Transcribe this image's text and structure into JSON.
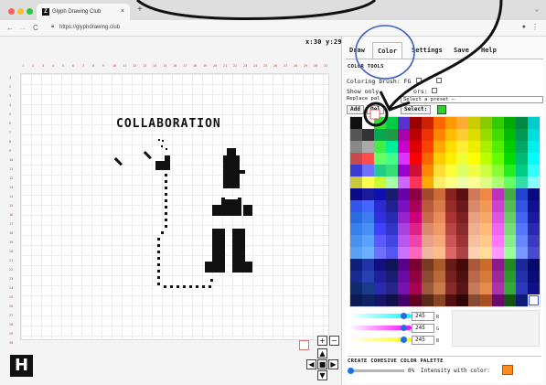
{
  "browser": {
    "tab_title": "Glyph Drawing Club",
    "tab_favicon": "Z",
    "new_tab": "+",
    "tab_menu": "⌄",
    "url": "https://glyphdrawing.club",
    "traffic_colors": {
      "close": "#ff5f57",
      "min": "#febc2e",
      "max": "#28c840"
    }
  },
  "workspace": {
    "coords": "x:30 y:29",
    "canvas_text": "COLLABORATION",
    "ruler_x": [
      "1",
      "2",
      "3",
      "4",
      "5",
      "6",
      "7",
      "8",
      "9",
      "10",
      "11",
      "12",
      "13",
      "14",
      "15",
      "16",
      "17",
      "18",
      "19",
      "20",
      "21",
      "22",
      "23",
      "24",
      "25",
      "26",
      "27",
      "28",
      "29",
      "30",
      "31"
    ],
    "ruler_y": [
      "1",
      "2",
      "3",
      "4",
      "5",
      "6",
      "7",
      "8",
      "9",
      "10",
      "11",
      "12",
      "13",
      "14",
      "15",
      "16",
      "17",
      "18",
      "19",
      "20",
      "21",
      "22",
      "23",
      "24",
      "25",
      "26",
      "27",
      "28",
      "29",
      "30"
    ],
    "ruler_highlight_color": "#e04040"
  },
  "panel": {
    "tabs": [
      {
        "label": "Draw",
        "active": false
      },
      {
        "label": "Color",
        "active": true
      },
      {
        "label": "Settings",
        "active": false
      },
      {
        "label": "Save",
        "active": false
      },
      {
        "label": "Help",
        "active": false
      }
    ],
    "color_tools_header": "COLOR TOOLS",
    "coloring_brush_label": "Coloring brush: FG",
    "show_only_label": "Show only",
    "show_only_suffix": "ors:",
    "replace_label": "Replace pal",
    "preset_placeholder": "Select a preset —",
    "add_button": "Add",
    "del_button": "Del",
    "select_button": "Select:",
    "select_color": "#33cc33",
    "rgb": [
      {
        "value": "245",
        "label": "R"
      },
      {
        "value": "245",
        "label": "G"
      },
      {
        "value": "245",
        "label": "B"
      }
    ],
    "cohesive_header": "CREATE COHESIVE COLOR PALETTE",
    "intensity_value": "0%",
    "intensity_label": "Intensity with color:",
    "intensity_color": "#ff8c1a"
  },
  "palette": {
    "columns": [
      [
        "#111111",
        "#555555",
        "#888888",
        "#c84a4a",
        "#3b3bd0",
        "#c8c83a",
        "#0a0a8a",
        "#3355ee",
        "#2a6be0",
        "#3a7ff0",
        "#4a90f0",
        "#5aa0f5",
        "#0f1f7a",
        "#1a2a90",
        "#102a6e",
        "#0c1a55"
      ],
      [
        "#ffffff",
        "#333333",
        "#aaaaaa",
        "#ff4d4d",
        "#7070ff",
        "#ffff4d",
        "#1a1aa0",
        "#4466ff",
        "#3b7cf0",
        "#4a8ff5",
        "#5aa0ff",
        "#6ab0ff",
        "#2233aa",
        "#2a3fb0",
        "#1a3a8a",
        "#102266"
      ],
      [
        "#33dd33",
        "#00aa55",
        "#44ee44",
        "#66ff66",
        "#22cc88",
        "#ccff33",
        "#1010b0",
        "#2a2ad0",
        "#3030e0",
        "#4040ff",
        "#5a5aff",
        "#7070ff",
        "#101080",
        "#20209a",
        "#2a2ab0",
        "#15156a"
      ],
      [
        "#00cc44",
        "#229944",
        "#00ee99",
        "#44ff88",
        "#33dd77",
        "#aaffaa",
        "#1a1a70",
        "#202090",
        "#2a2ab0",
        "#3535c8",
        "#4545e0",
        "#5555f0",
        "#121258",
        "#1c1c72",
        "#26268a",
        "#10104a"
      ],
      [
        "#5533cc",
        "#aa00aa",
        "#cc00cc",
        "#dd33ff",
        "#9900cc",
        "#cc66ff",
        "#6a00aa",
        "#7a10c0",
        "#9a20d0",
        "#aa40e0",
        "#bb55f0",
        "#cc70ff",
        "#5a0088",
        "#6a0aa0",
        "#7a10b0",
        "#440066"
      ],
      [
        "#990000",
        "#bb0000",
        "#dd0000",
        "#ff0000",
        "#cc1133",
        "#ff3355",
        "#8a0040",
        "#aa0055",
        "#cc0077",
        "#dd2288",
        "#ee44aa",
        "#ff66bb",
        "#7a0030",
        "#900040",
        "#aa0050",
        "#600025"
      ],
      [
        "#cc2200",
        "#ee3300",
        "#ff4400",
        "#ff6600",
        "#ff8800",
        "#ffaa00",
        "#a04a2a",
        "#b85a3a",
        "#c86a4a",
        "#d88a6a",
        "#e8a08a",
        "#f0b8a0",
        "#7a3a22",
        "#8a4a30",
        "#9a5a3a",
        "#5a2a18"
      ],
      [
        "#ff6600",
        "#ff8800",
        "#ffaa00",
        "#ffcc00",
        "#ffdd33",
        "#ffee66",
        "#cc6a3a",
        "#d87a4a",
        "#e88a5a",
        "#f09a6a",
        "#f5aa7a",
        "#ffbb8a",
        "#aa5a2a",
        "#b86a3a",
        "#c87a4a",
        "#884422"
      ],
      [
        "#ff9900",
        "#ffbb00",
        "#ffdd00",
        "#ffee00",
        "#ffff33",
        "#ffff88",
        "#882222",
        "#992a2a",
        "#aa3333",
        "#bb4444",
        "#cc5555",
        "#dd6666",
        "#661a1a",
        "#772222",
        "#882a2a",
        "#501010"
      ],
      [
        "#ffaa33",
        "#ffcc33",
        "#ffee33",
        "#eeff33",
        "#ddff66",
        "#eeffaa",
        "#5a1010",
        "#6a1a1a",
        "#7a2222",
        "#8a2a2a",
        "#9a3333",
        "#aa4444",
        "#440a0a",
        "#501010",
        "#5a1515",
        "#300505"
      ],
      [
        "#cccc00",
        "#dddd00",
        "#eeee00",
        "#ffff00",
        "#eeff44",
        "#ffff99",
        "#cc7a5a",
        "#d88a6a",
        "#e8a080",
        "#f0b090",
        "#f5c0a0",
        "#ffd0b0",
        "#aa5a3a",
        "#b86a4a",
        "#c87a5a",
        "#884a30"
      ],
      [
        "#88cc00",
        "#99dd00",
        "#aaee00",
        "#bbff00",
        "#ccff44",
        "#ddff88",
        "#ee8844",
        "#f09a55",
        "#f5aa66",
        "#ffbb77",
        "#ffcc88",
        "#ffdd99",
        "#cc6a2a",
        "#d87a3a",
        "#e88a4a",
        "#aa5020"
      ],
      [
        "#33cc00",
        "#44dd00",
        "#55ee00",
        "#66ff00",
        "#88ff33",
        "#aaff77",
        "#bb33bb",
        "#cc44cc",
        "#dd55dd",
        "#ee66ee",
        "#ff77ff",
        "#ff99ff",
        "#8a1a8a",
        "#9a2a9a",
        "#aa33aa",
        "#6a0a6a"
      ],
      [
        "#00aa00",
        "#00bb00",
        "#00cc00",
        "#00dd00",
        "#22ee22",
        "#66ff66",
        "#44aa44",
        "#55bb55",
        "#66cc66",
        "#77dd77",
        "#88ee88",
        "#99ff99",
        "#228822",
        "#2a9a2a",
        "#33aa33",
        "#115511"
      ],
      [
        "#008844",
        "#009955",
        "#00aa66",
        "#00bb77",
        "#00cc88",
        "#33ddaa",
        "#2244cc",
        "#3355dd",
        "#4466ee",
        "#5577ff",
        "#6688ff",
        "#7799ff",
        "#1a2a99",
        "#2233aa",
        "#2a3abb",
        "#101a77"
      ],
      [
        "#00cccc",
        "#00dddd",
        "#00eeee",
        "#00ffff",
        "#33ffff",
        "#88ffff",
        "#0a0a80",
        "#101090",
        "#1a1aa0",
        "#2a2ab0",
        "#3a3ac0",
        "#4a4ad0",
        "#08086a",
        "#0c0c78",
        "#101088",
        "#ffffff"
      ]
    ]
  }
}
